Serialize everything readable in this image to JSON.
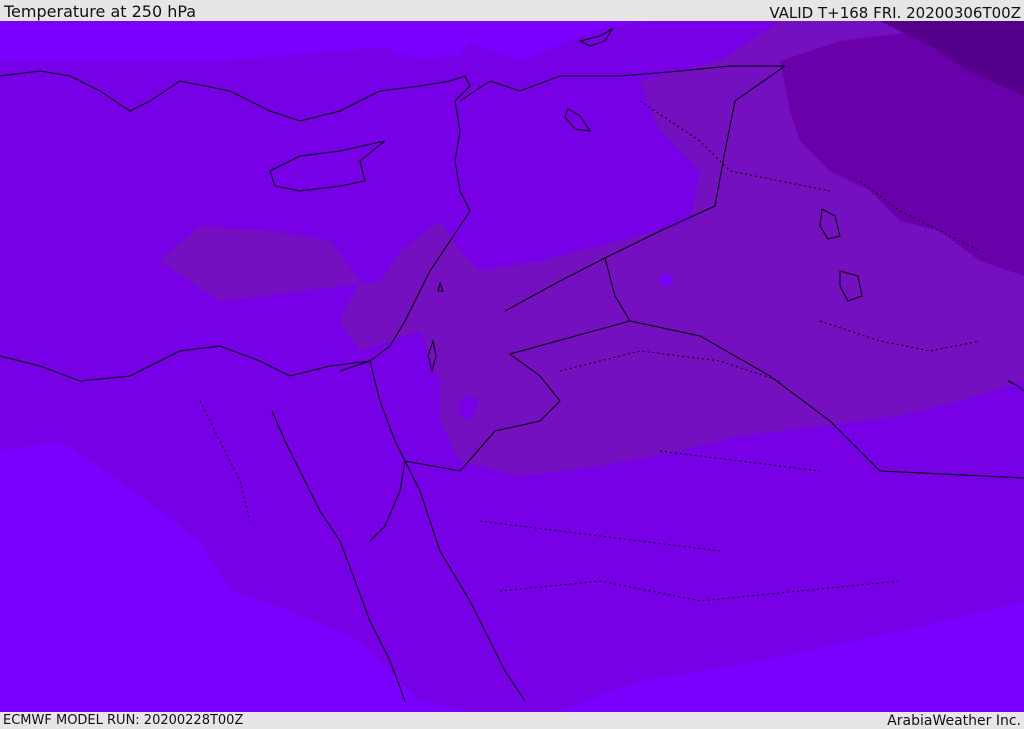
{
  "header": {
    "title": "Temperature at 250 hPa",
    "valid": "VALID T+168 FRI. 20200306T00Z"
  },
  "footer": {
    "model_run": "ECMWF MODEL RUN: 20200228T00Z",
    "brand": "ArabiaWeather Inc."
  },
  "map": {
    "colors": {
      "band_1": "#7b00ff",
      "band_2": "#7700e6",
      "band_3": "#7410bf",
      "band_4": "#6a00aa",
      "band_5": "#55008c",
      "coastline": "#000000"
    }
  }
}
